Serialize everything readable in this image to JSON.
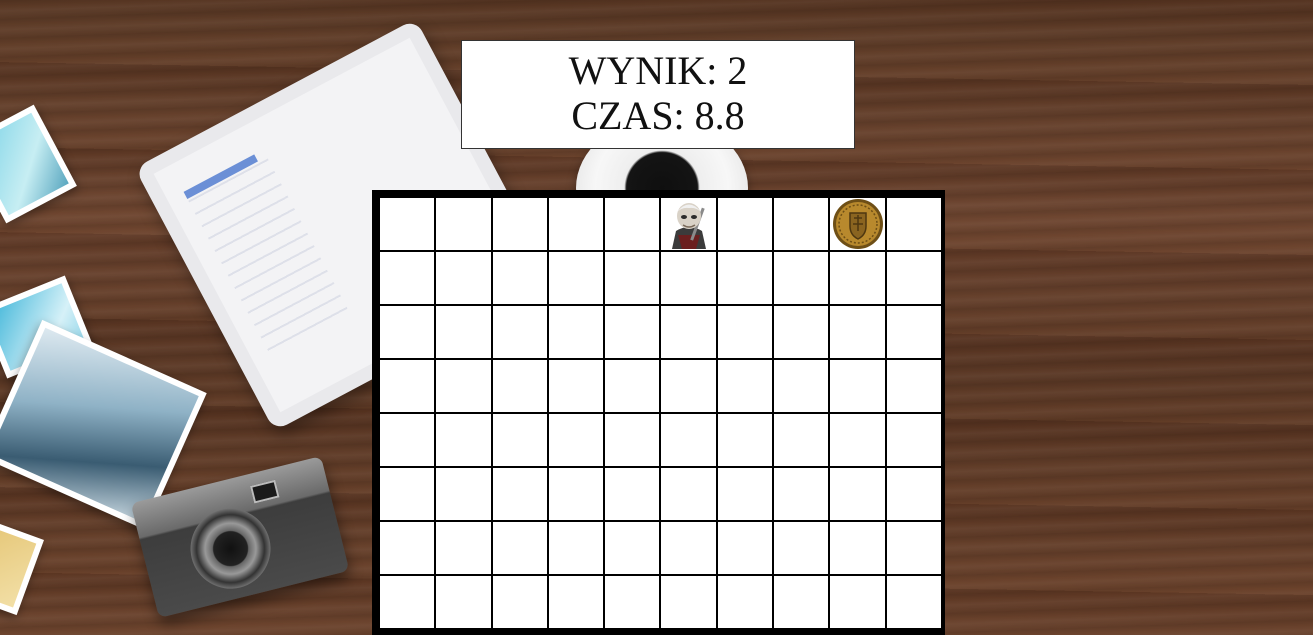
{
  "scoreboard": {
    "score_line": "WYNIK: 2",
    "time_line": "CZAS: 8.8"
  },
  "board": {
    "columns": 10,
    "rows_visible": 8,
    "player": {
      "row": 0,
      "col": 5,
      "icon": "witcher-character-icon"
    },
    "coin": {
      "row": 0,
      "col": 8,
      "icon": "gold-coin-icon"
    }
  },
  "colors": {
    "cell": "#ffffff",
    "grid_line": "#000000",
    "coin_gold": "#b8892d"
  }
}
